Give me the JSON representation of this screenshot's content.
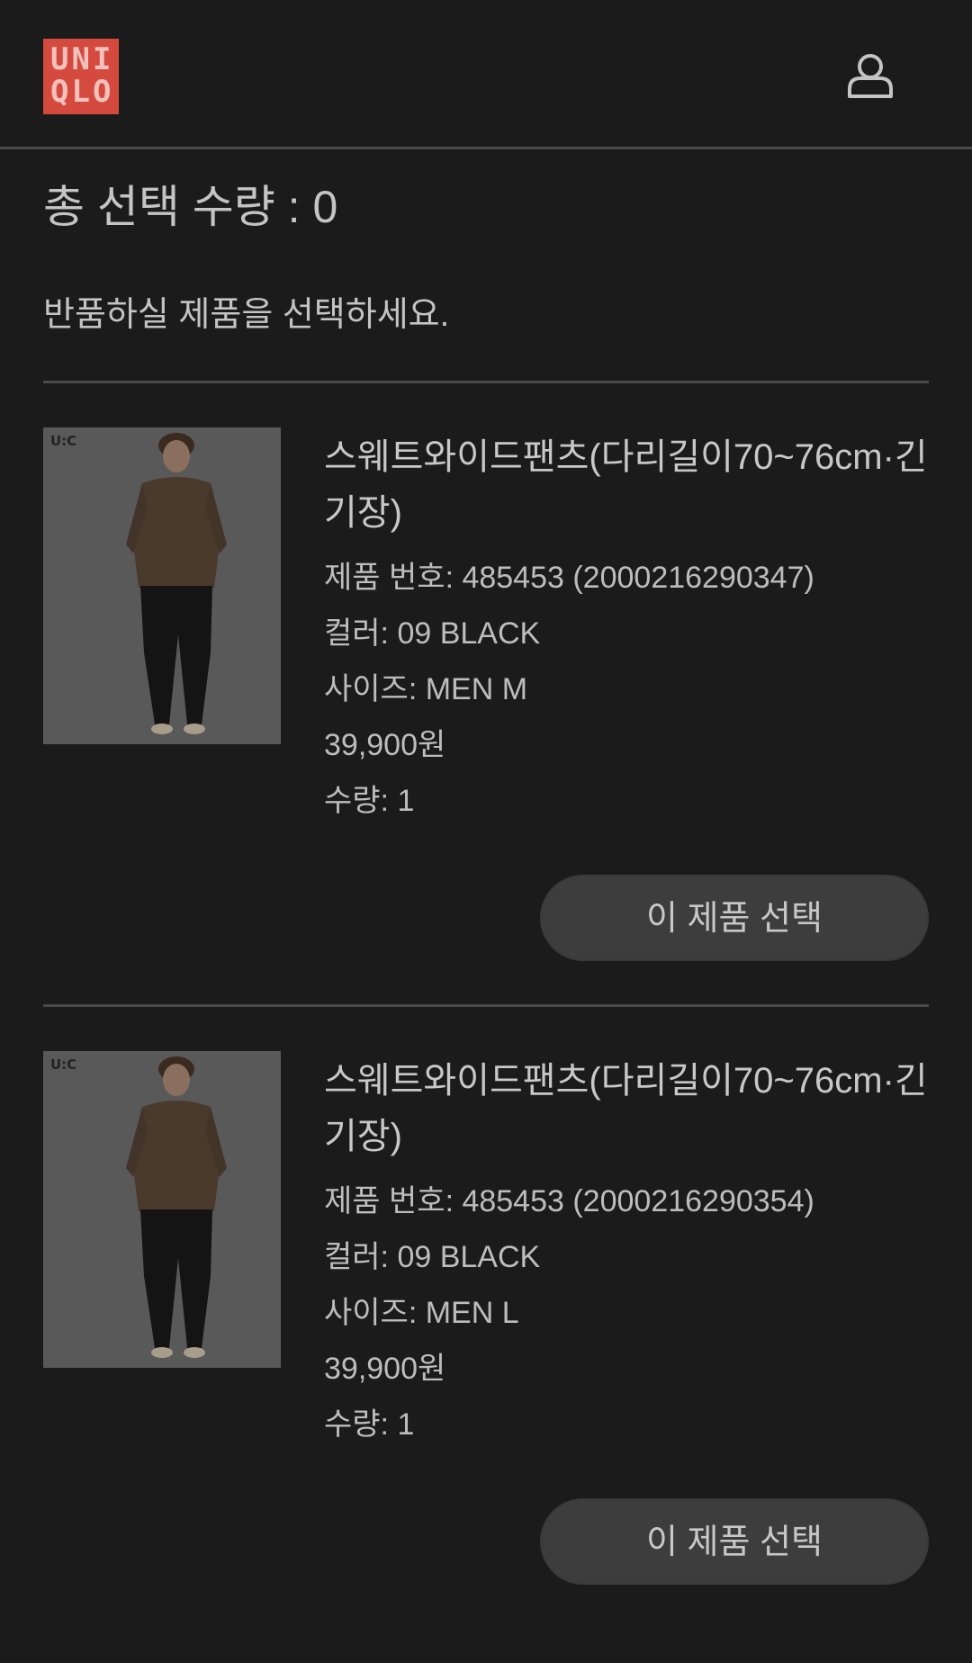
{
  "header": {
    "logo_line1": "UNI",
    "logo_line2": "QLO",
    "account_icon": "user-icon",
    "logo_color": "#d44a3f"
  },
  "summary": {
    "total_selected": "총 선택 수량 : 0",
    "instruction": "반품하실 제품을 선택하세요."
  },
  "products": [
    {
      "badge": "U:C",
      "name": "스웨트와이드팬츠(다리길이70~76cm·긴기장)",
      "product_number": "제품 번호: 485453 (2000216290347)",
      "color": "컬러: 09 BLACK",
      "size": "사이즈: MEN M",
      "price": "39,900원",
      "quantity": "수량: 1",
      "select_label": "이 제품 선택"
    },
    {
      "badge": "U:C",
      "name": "스웨트와이드팬츠(다리길이70~76cm·긴기장)",
      "product_number": "제품 번호: 485453 (2000216290354)",
      "color": "컬러: 09 BLACK",
      "size": "사이즈: MEN L",
      "price": "39,900원",
      "quantity": "수량: 1",
      "select_label": "이 제품 선택"
    }
  ],
  "colors": {
    "background": "#1b1b1b",
    "button": "#3d3d3d",
    "divider": "#4a4a4a"
  }
}
